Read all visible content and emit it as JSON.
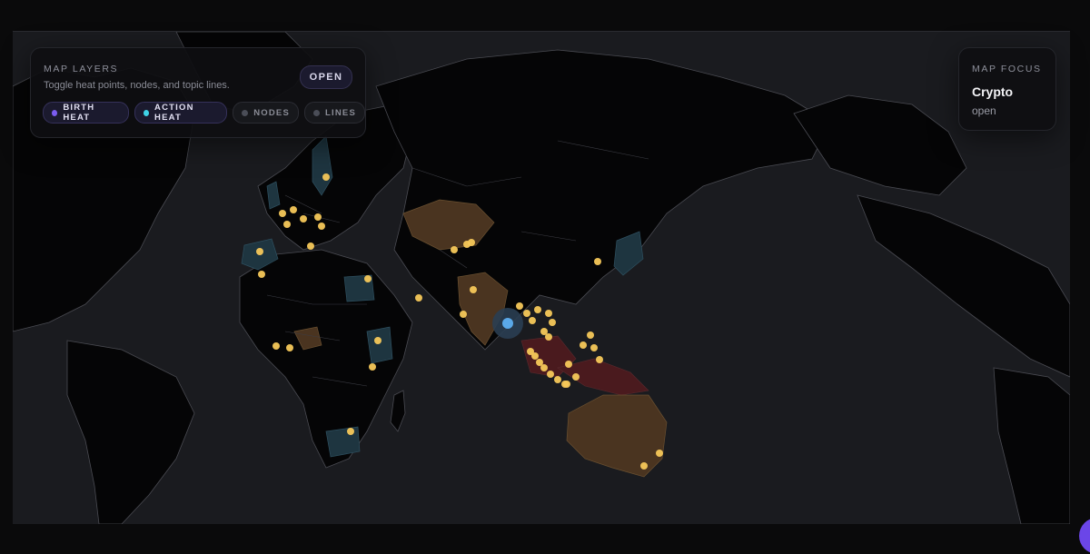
{
  "layers_panel": {
    "title": "MAP LAYERS",
    "subtitle": "Toggle heat points, nodes, and topic lines.",
    "open_label": "OPEN",
    "chips": [
      {
        "label": "BIRTH HEAT",
        "active": true,
        "dot_color": "#7b5cf0"
      },
      {
        "label": "ACTION HEAT",
        "active": true,
        "dot_color": "#3fd3e6"
      },
      {
        "label": "NODES",
        "active": false,
        "dot_color": "#4a4d57"
      },
      {
        "label": "LINES",
        "active": false,
        "dot_color": "#4a4d57"
      }
    ]
  },
  "focus_panel": {
    "title": "MAP FOCUS",
    "value": "Crypto",
    "status": "open"
  },
  "colors": {
    "map_background": "#1a1b1f",
    "land": "#050506",
    "highlight_brown": "#4a3420",
    "highlight_teal": "#1e3540",
    "highlight_red": "#4a1a1e",
    "heat_point": "#f5c85a",
    "focus_node": "#5aa8e8",
    "accent": "#6b46e8"
  }
}
